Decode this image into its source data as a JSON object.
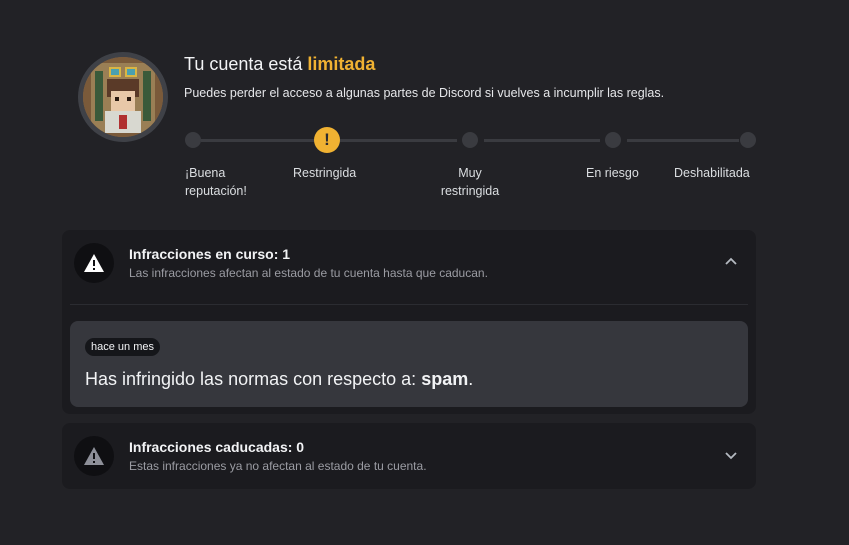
{
  "header": {
    "title_prefix": "Tu cuenta está",
    "title_highlight": "limitada",
    "subtitle": "Puedes perder el acceso a algunas partes de Discord si vuelves a incumplir las reglas."
  },
  "progress": {
    "active_index": 1,
    "active_icon": "!",
    "steps": [
      {
        "label_line1": "¡Buena",
        "label_line2": "reputación!"
      },
      {
        "label_line1": "Restringida",
        "label_line2": ""
      },
      {
        "label_line1": "Muy",
        "label_line2": "restringida"
      },
      {
        "label_line1": "En riesgo",
        "label_line2": ""
      },
      {
        "label_line1": "Deshabilitada",
        "label_line2": ""
      }
    ]
  },
  "active_infractions": {
    "title": "Infracciones en curso: 1",
    "description": "Las infracciones afectan al estado de tu cuenta hasta que caducan.",
    "item": {
      "time": "hace un mes",
      "text_prefix": "Has infringido las normas con respecto a:",
      "reason": "spam",
      "text_suffix": "."
    }
  },
  "expired_infractions": {
    "title": "Infracciones caducadas: 0",
    "description": "Estas infracciones ya no afectan al estado de tu cuenta."
  },
  "colors": {
    "accent": "#f0b232",
    "background": "#222226",
    "card": "#1b1b1f"
  }
}
